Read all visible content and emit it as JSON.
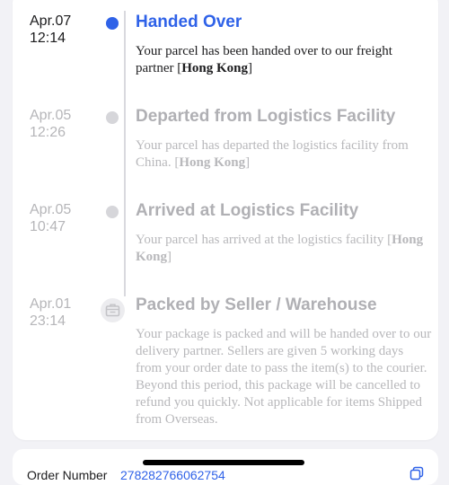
{
  "timeline": {
    "events": [
      {
        "date": "Apr.07",
        "time": "12:14",
        "title": "Handed Over",
        "desc_text": "Your parcel has been handed over to our freight partner [",
        "desc_bold": "Hong Kong",
        "desc_end": "]",
        "status": "active",
        "icon": "dot-icon"
      },
      {
        "date": "Apr.05",
        "time": "12:26",
        "title": "Departed from Logistics Facility",
        "desc_text": "Your parcel has departed the logistics facility from China. [",
        "desc_bold": "Hong Kong",
        "desc_end": "]",
        "status": "inactive",
        "icon": "dot-icon"
      },
      {
        "date": "Apr.05",
        "time": "10:47",
        "title": "Arrived at Logistics Facility",
        "desc_text": "Your parcel has arrived at the logistics facility [",
        "desc_bold": "Hong Kong",
        "desc_end": "]",
        "status": "inactive",
        "icon": "dot-icon"
      },
      {
        "date": "Apr.01",
        "time": "23:14",
        "title": "Packed by Seller / Warehouse",
        "desc_text": "Your package is packed and will be handed over to our delivery partner. Sellers are given 5 working days from your order date to pass the item(s) to the courier. Beyond this period, this package will be cancelled to refund you quickly. Not applicable for items Shipped from Overseas.",
        "status": "inactive",
        "icon": "package-icon"
      }
    ]
  },
  "order": {
    "label": "Order Number",
    "number": "278282766062754"
  },
  "colors": {
    "accent": "#2f62e8",
    "inactive": "#b0b0b4"
  }
}
